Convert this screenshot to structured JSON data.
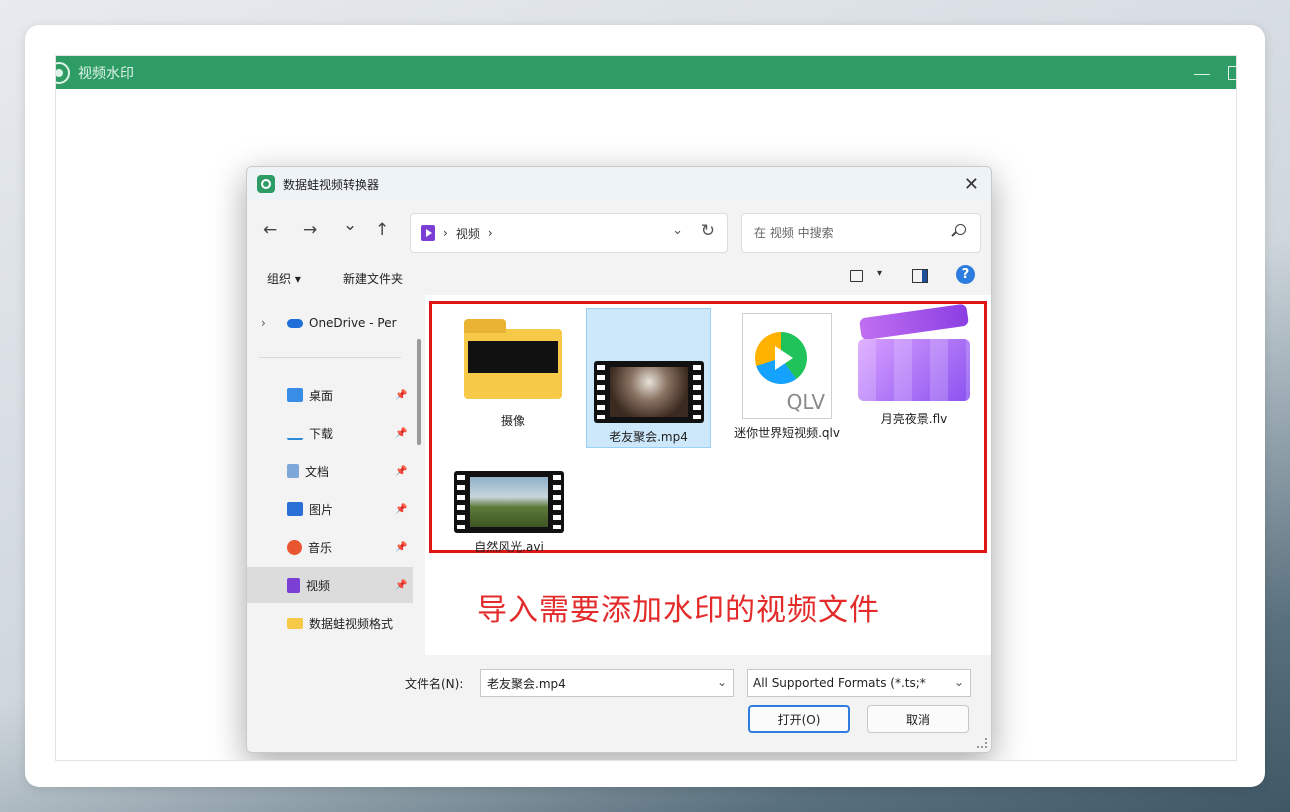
{
  "app": {
    "title": "视频水印"
  },
  "dialog": {
    "title": "数据蛙视频转换器",
    "close": "✕",
    "nav": {
      "back": "←",
      "forward": "→",
      "recent": "⌄",
      "up": "↑",
      "breadcrumb_sep": "›",
      "breadcrumb": "视频",
      "dropdown": "⌄",
      "refresh": "↻"
    },
    "search": {
      "placeholder": "在 视频 中搜索"
    },
    "toolbar": {
      "organize": "组织 ▾",
      "new_folder": "新建文件夹",
      "view_dropdown": "▾",
      "help": "?"
    },
    "sidebar": {
      "items": [
        {
          "label": "OneDrive - Per",
          "icon": "cloud-icon",
          "color": "#1e6fd9"
        },
        {
          "label": "桌面",
          "icon": "desktop-icon",
          "color": "#3a8de6"
        },
        {
          "label": "下载",
          "icon": "download-icon",
          "color": "#2a8ad9"
        },
        {
          "label": "文档",
          "icon": "document-icon",
          "color": "#7da7d9"
        },
        {
          "label": "图片",
          "icon": "pictures-icon",
          "color": "#2a6fd6"
        },
        {
          "label": "音乐",
          "icon": "music-icon",
          "color": "#e8552f"
        },
        {
          "label": "视频",
          "icon": "video-icon",
          "color": "#7b3fd6"
        },
        {
          "label": "数据蛙视频格式",
          "icon": "folder-icon",
          "color": "#f7c948"
        }
      ],
      "pin": "📌"
    },
    "files": [
      {
        "name": "摄像",
        "type": "folder"
      },
      {
        "name": "老友聚会.mp4",
        "type": "video"
      },
      {
        "name": "迷你世界短视频.qlv",
        "type": "qlv",
        "ext_label": "QLV"
      },
      {
        "name": "月亮夜景.flv",
        "type": "flv"
      },
      {
        "name": "自然风光.avi",
        "type": "avi"
      }
    ],
    "annotation": "导入需要添加水印的视频文件",
    "filename_label": "文件名(N):",
    "filename_value": "老友聚会.mp4",
    "filter_value": "All Supported Formats (*.ts;*",
    "open_button": "打开(O)",
    "cancel_button": "取消"
  },
  "colors": {
    "app_green": "#2e9c64",
    "highlight_red": "#e01515",
    "annotation_red": "#e32b2b",
    "selected_bg": "#cde8fb"
  }
}
